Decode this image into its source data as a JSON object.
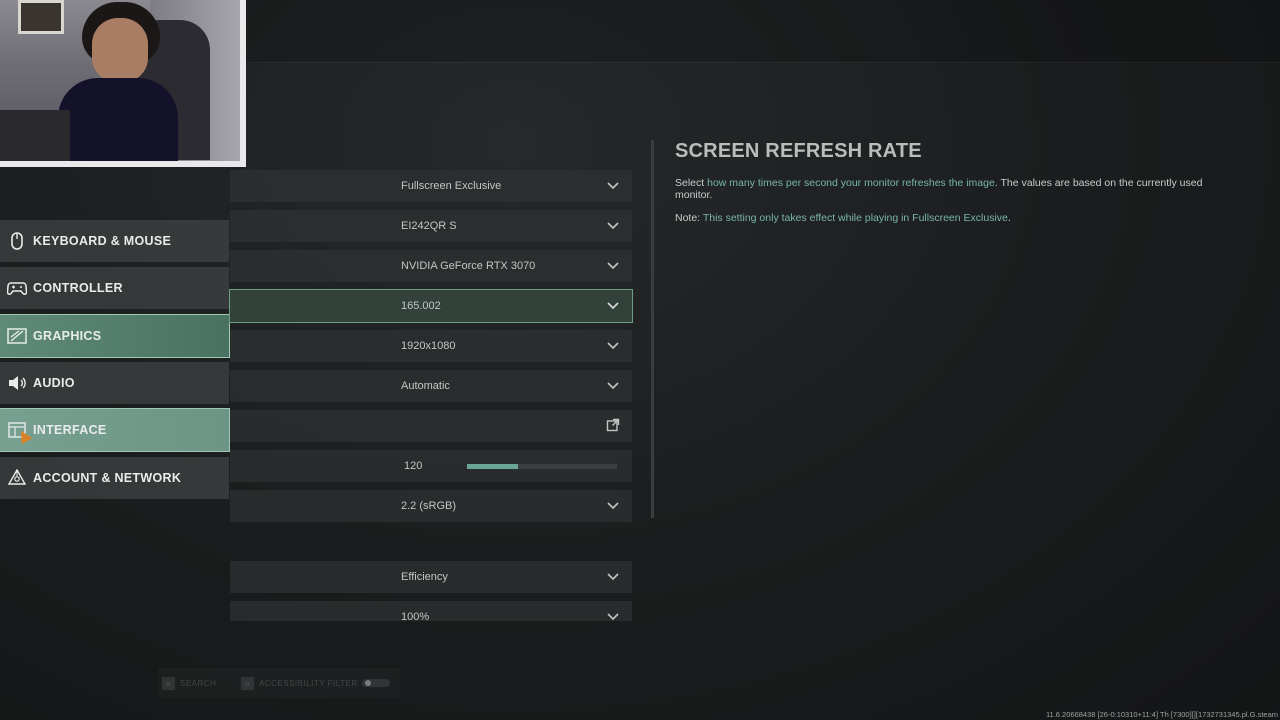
{
  "nav": {
    "items": [
      {
        "label": "KEYBOARD & MOUSE",
        "icon": "mouse-icon",
        "selected": false
      },
      {
        "label": "CONTROLLER",
        "icon": "gamepad-icon",
        "selected": false
      },
      {
        "label": "GRAPHICS",
        "icon": "graphics-icon",
        "selected": true
      },
      {
        "label": "AUDIO",
        "icon": "speaker-icon",
        "selected": false
      },
      {
        "label": "INTERFACE",
        "icon": "interface-icon",
        "selected": true
      },
      {
        "label": "ACCOUNT & NETWORK",
        "icon": "network-icon",
        "selected": false
      }
    ]
  },
  "settings": {
    "display_mode": "Fullscreen Exclusive",
    "display_monitor": "EI242QR S",
    "display_adapter": "NVIDIA GeForce RTX 3070",
    "screen_refresh_rate": "165.002",
    "display_resolution": "1920x1080",
    "dynamic_resolution": "Automatic",
    "custom_frame_rate_value": "120",
    "custom_frame_rate_fraction": 0.34,
    "display_gamma": "2.2 (sRGB)",
    "quality_preset": "Efficiency",
    "render_resolution": "100%"
  },
  "description": {
    "title": "SCREEN REFRESH RATE",
    "line_prefix": "Select ",
    "line_highlight": "how many times per second your monitor refreshes the image",
    "line_suffix": ". The values are based on the currently used monitor.",
    "note_label": "Note: ",
    "note_highlight": "This setting only takes effect while playing in ",
    "note_highlight_2": "Fullscreen Exclusive",
    "note_end": "."
  },
  "bottom": {
    "accessibility_filter": "ACCESSIBILITY FILTER",
    "search": "SEARCH"
  },
  "version": "11.6.20668438 [26-0:10310+11:4] Th [7300][][1732731345.pl.G.steam",
  "colors": {
    "accent": "#6aa596",
    "selected_nav": "#5f8a78",
    "highlight_text": "#79b6a6"
  }
}
